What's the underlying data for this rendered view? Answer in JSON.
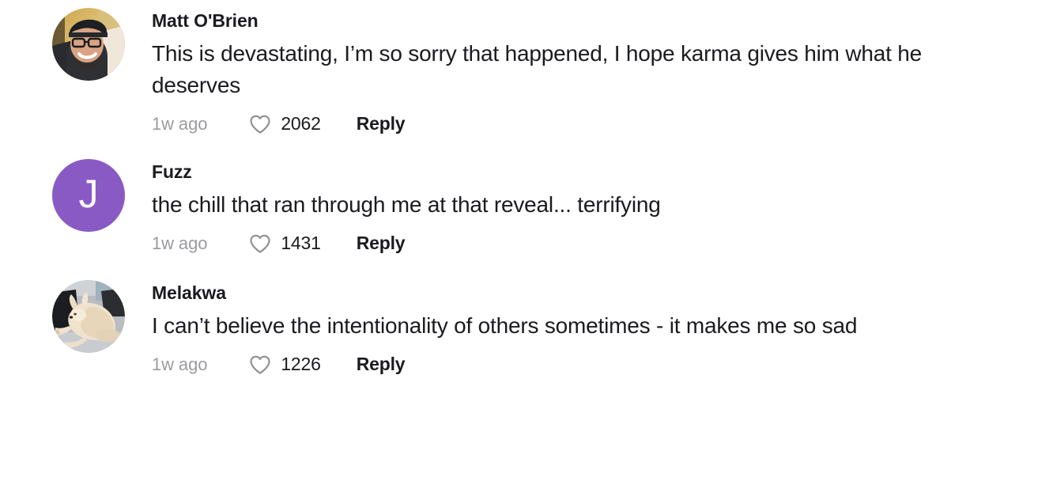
{
  "theme": {
    "background": "#ffffff",
    "text_color": "#1b1b1f",
    "muted_color": "#9b9b9f",
    "heart_color": "#8e8e93",
    "avatar_purple": "#8a5ac4"
  },
  "comments": [
    {
      "username": "Matt O'Brien",
      "text": "This is devastating, I’m so sorry that happened, I hope karma gives him what he deserves",
      "timestamp": "1w ago",
      "like_count": "2062",
      "reply_label": "Reply",
      "avatar": {
        "type": "photo",
        "alt": "photo of a smiling man wearing a cap and glasses"
      }
    },
    {
      "username": "Fuzz",
      "text": "the chill that ran through me at that reveal... terrifying",
      "timestamp": "1w ago",
      "like_count": "1431",
      "reply_label": "Reply",
      "avatar": {
        "type": "initial",
        "initial": "J",
        "background": "#8a5ac4"
      }
    },
    {
      "username": "Melakwa",
      "text": "I can’t believe the intentionality of others sometimes - it makes me so sad",
      "timestamp": "1w ago",
      "like_count": "1226",
      "reply_label": "Reply",
      "avatar": {
        "type": "photo",
        "alt": "photo of a cream colored dog lying down"
      }
    }
  ],
  "icons": {
    "heart": "heart-outline-icon"
  }
}
